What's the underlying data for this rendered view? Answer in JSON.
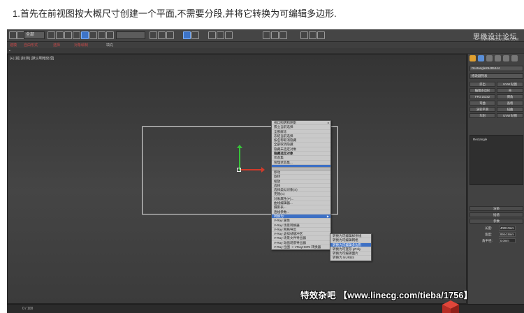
{
  "caption": "1.首先在前视图按大概尺寸创建一个平面,不需要分段,并将它转换为可编辑多边形.",
  "toolbar": {
    "selection_dropdown": "全部",
    "brand": "思缘设计论坛",
    "brand_sub": "WWW.MISSVUAN.COM"
  },
  "ribbon": {
    "items": [
      "建模",
      "自由形式",
      "选择",
      "对象绘制",
      "填充"
    ]
  },
  "viewport": {
    "label": "[+] [前] [标准] [默认明暗处理]"
  },
  "context_menu": {
    "items": [
      "视口照明和阴影",
      "孤立当前选择",
      "全部解冻",
      "冻结当前选择",
      "按名称取消隐藏",
      "全部取消隐藏",
      "隐藏未选定对象",
      "隐藏选定对象",
      "状态集",
      "管理状态集...",
      "",
      "",
      "移动",
      "旋转",
      "缩放",
      "选择",
      "选择类似对象(S)",
      "克隆(C)",
      "对象属性(P)...",
      "曲线编辑器...",
      "摄影表...",
      "连线参数...",
      "转换为:",
      "V-Ray 属性",
      "V-Ray 场景转换器",
      "V-Ray 网格导出",
      "V-Ray 虚拟帧缓冲区",
      "V-Ray 场景文件导出器",
      "V-Ray 动画场景导出器",
      "V-Ray 位图 -> VRayHDRI 转换器"
    ]
  },
  "submenu": {
    "items": [
      "转换为可编辑样条线",
      "转换为可编辑网格",
      "转换为可编辑多边形",
      "转换为可变形 gPoly",
      "转换为可编辑面片",
      "转换为 NURBS"
    ]
  },
  "command_panel": {
    "object_name": "Rectangle25485444",
    "modifier_list": "修改器列表",
    "buttons": [
      "挤出",
      "UVW 贴图",
      "编辑多边形",
      "壳",
      "FFD 2x2x2",
      "倒角",
      "弯曲",
      "晶格",
      "涡轮平滑",
      "扭曲",
      "车削",
      "UVW 贴图"
    ],
    "stack_item": "Rectangle",
    "rollouts": [
      "渲染",
      "插值",
      "参数"
    ],
    "params": [
      {
        "label": "长度:",
        "value": "4000.0mm"
      },
      {
        "label": "宽度:",
        "value": "8944.8mm"
      },
      {
        "label": "角半径:",
        "value": "0.0mm"
      }
    ]
  },
  "status": {
    "frame": "0 / 100"
  },
  "watermark": "特效杂吧 【www.linecg.com/tieba/1756】"
}
